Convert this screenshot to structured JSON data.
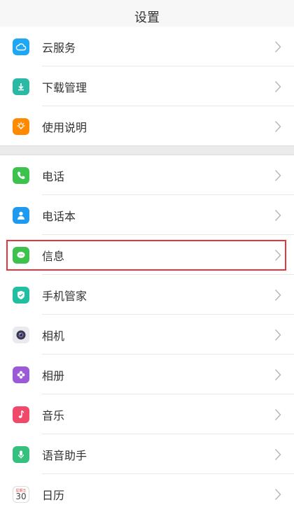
{
  "header": {
    "title": "设置"
  },
  "group1": [
    {
      "label": "云服务",
      "icon": "cloud-icon",
      "color": "#1ea7f5"
    },
    {
      "label": "下载管理",
      "icon": "download-icon",
      "color": "#2bb9a6"
    },
    {
      "label": "使用说明",
      "icon": "lightbulb-icon",
      "color": "#ff8a00"
    }
  ],
  "group2": [
    {
      "label": "电话",
      "icon": "phone-icon",
      "color": "#3dc24d"
    },
    {
      "label": "电话本",
      "icon": "contacts-icon",
      "color": "#1e9af0"
    },
    {
      "label": "信息",
      "icon": "message-icon",
      "color": "#3dc24d"
    },
    {
      "label": "手机管家",
      "icon": "shield-icon",
      "color": "#20bfa0"
    },
    {
      "label": "相机",
      "icon": "camera-icon",
      "color": "#e9e9ef"
    },
    {
      "label": "相册",
      "icon": "gallery-flower-icon",
      "color": "#9b5bd6"
    },
    {
      "label": "音乐",
      "icon": "music-note-icon",
      "color": "#f04a6a"
    },
    {
      "label": "语音助手",
      "icon": "microphone-icon",
      "color": "#36c07e"
    },
    {
      "label": "日历",
      "icon": "calendar-icon",
      "color": "#ffffff",
      "cal_header": "星期五",
      "cal_day": "30"
    }
  ],
  "highlight_color": "#e5373b"
}
